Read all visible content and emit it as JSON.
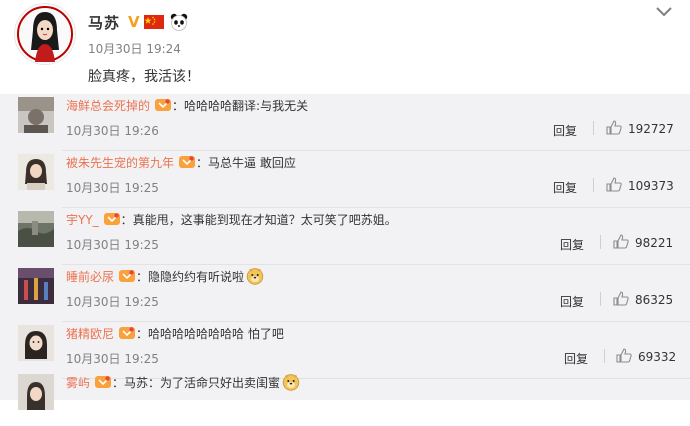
{
  "post": {
    "author": "马苏",
    "verified_mark": "V",
    "icons": [
      "verified-badge-icon",
      "china-flag-icon",
      "panda-icon"
    ],
    "time": "10月30日 19:24",
    "text": "脸真疼，我活该！"
  },
  "comments": [
    {
      "user": "海鲜总会死掉的",
      "separator": "：",
      "text": "哈哈哈哈翻译:与我无关",
      "time": "10月30日 19:26",
      "reply": "回复",
      "likes": "192727",
      "emoji": false
    },
    {
      "user": "被朱先生宠的第九年",
      "separator": "：",
      "text": "马总牛逼 敢回应",
      "time": "10月30日 19:25",
      "reply": "回复",
      "likes": "109373",
      "emoji": false
    },
    {
      "user": "宇YY_",
      "separator": "：",
      "text": "真能甩，这事能到现在才知道？太可笑了吧苏姐。",
      "time": "10月30日 19:25",
      "reply": "回复",
      "likes": "98221",
      "emoji": false
    },
    {
      "user": "睡前必尿",
      "separator": "：",
      "text": "隐隐约约有听说啦",
      "time": "10月30日 19:25",
      "reply": "回复",
      "likes": "86325",
      "emoji": true
    },
    {
      "user": "猪精欧尼",
      "separator": "：",
      "text": "哈哈哈哈哈哈哈哈 怕了吧",
      "time": "10月30日 19:25",
      "reply": "回复",
      "likes": "69332",
      "emoji": false
    },
    {
      "user": "雾屿",
      "separator": "：",
      "text": "马苏：为了活命只好出卖闺蜜",
      "time": "",
      "reply": "",
      "likes": "",
      "emoji": true
    }
  ],
  "colors": {
    "username": "#eb7350",
    "comments_bg": "#f2f2f5",
    "verified": "#f7a11b"
  }
}
